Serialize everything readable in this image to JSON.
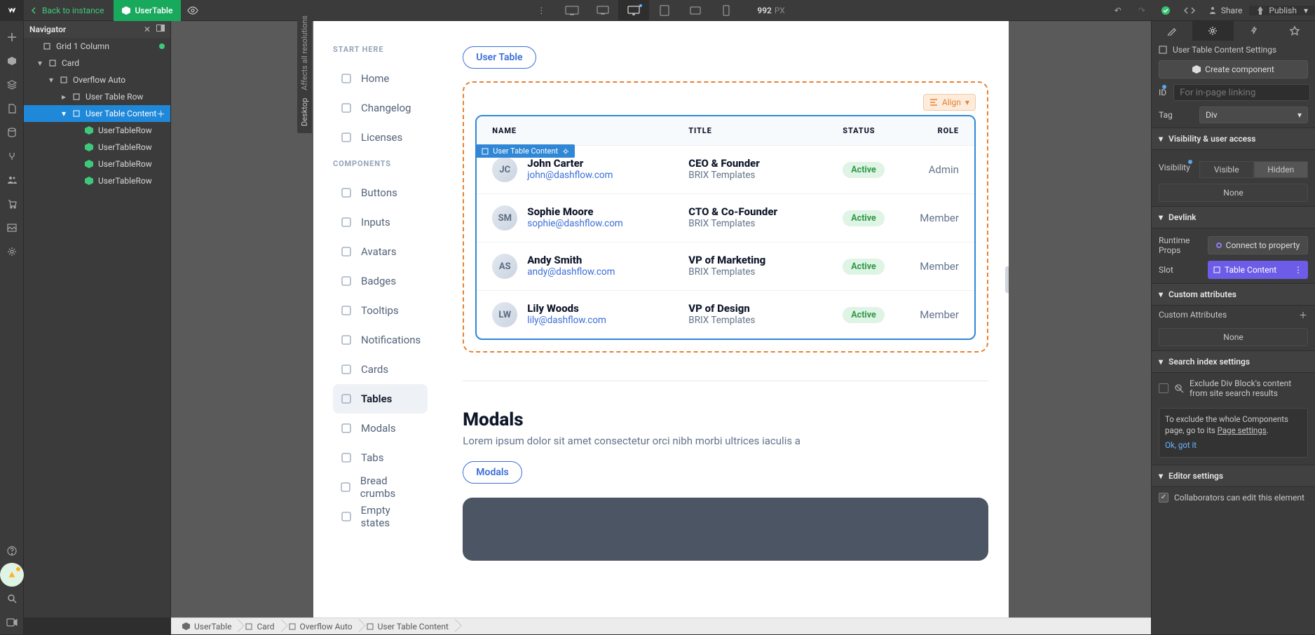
{
  "topbar": {
    "back": "Back to instance",
    "componentName": "UserTable",
    "canvasWidth": "992",
    "canvasUnit": "PX",
    "share": "Share",
    "publish": "Publish"
  },
  "desktopLabel": "Desktop",
  "affectsLabel": "Affects all resolutions",
  "navigator": {
    "title": "Navigator",
    "items": [
      {
        "level": 0,
        "icon": "square",
        "label": "Grid 1 Column",
        "caret": false,
        "dot": true
      },
      {
        "level": 1,
        "icon": "square",
        "label": "Card",
        "caret": true
      },
      {
        "level": 2,
        "icon": "square",
        "label": "Overflow Auto",
        "caret": true
      },
      {
        "level": 3,
        "icon": "square",
        "label": "User Table Row",
        "caret": true,
        "collapsed": true
      },
      {
        "level": 3,
        "icon": "square",
        "label": "User Table Content",
        "caret": true,
        "selected": true,
        "gear": true
      },
      {
        "level": 4,
        "icon": "comp",
        "label": "UserTableRow"
      },
      {
        "level": 4,
        "icon": "comp",
        "label": "UserTableRow"
      },
      {
        "level": 4,
        "icon": "comp",
        "label": "UserTableRow"
      },
      {
        "level": 4,
        "icon": "comp",
        "label": "UserTableRow"
      }
    ]
  },
  "sidebar": {
    "sections": [
      {
        "title": "START HERE",
        "items": [
          {
            "icon": "home",
            "label": "Home"
          },
          {
            "icon": "changelog",
            "label": "Changelog"
          },
          {
            "icon": "licenses",
            "label": "Licenses"
          }
        ]
      },
      {
        "title": "COMPONENTS",
        "items": [
          {
            "icon": "buttons",
            "label": "Buttons"
          },
          {
            "icon": "inputs",
            "label": "Inputs"
          },
          {
            "icon": "avatars",
            "label": "Avatars"
          },
          {
            "icon": "badges",
            "label": "Badges"
          },
          {
            "icon": "tooltips",
            "label": "Tooltips"
          },
          {
            "icon": "notifications",
            "label": "Notifications"
          },
          {
            "icon": "cards",
            "label": "Cards"
          },
          {
            "icon": "tables",
            "label": "Tables",
            "active": true
          },
          {
            "icon": "modals",
            "label": "Modals"
          },
          {
            "icon": "tabs",
            "label": "Tabs"
          },
          {
            "icon": "breadcrumbs",
            "label": "Bread crumbs"
          },
          {
            "icon": "empty",
            "label": "Empty states"
          }
        ]
      }
    ]
  },
  "userTable": {
    "pill": "User Table",
    "alignBtn": "Align",
    "selectedTag": "User Table Content",
    "headers": {
      "name": "NAME",
      "title": "TITLE",
      "status": "STATUS",
      "role": "ROLE"
    },
    "rows": [
      {
        "initials": "JC",
        "name": "John Carter",
        "email": "john@dashflow.com",
        "title": "CEO & Founder",
        "org": "BRIX Templates",
        "status": "Active",
        "role": "Admin"
      },
      {
        "initials": "SM",
        "name": "Sophie Moore",
        "email": "sophie@dashflow.com",
        "title": "CTO & Co-Founder",
        "org": "BRIX Templates",
        "status": "Active",
        "role": "Member"
      },
      {
        "initials": "AS",
        "name": "Andy Smith",
        "email": "andy@dashflow.com",
        "title": "VP of Marketing",
        "org": "BRIX Templates",
        "status": "Active",
        "role": "Member"
      },
      {
        "initials": "LW",
        "name": "Lily Woods",
        "email": "lily@dashflow.com",
        "title": "VP of Design",
        "org": "BRIX Templates",
        "status": "Active",
        "role": "Member"
      }
    ]
  },
  "modalsSection": {
    "title": "Modals",
    "desc": "Lorem ipsum dolor sit amet consectetur orci nibh morbi ultrices iaculis a",
    "pill": "Modals"
  },
  "breadcrumbs": [
    "UserTable",
    "Card",
    "Overflow Auto",
    "User Table Content"
  ],
  "inspector": {
    "headerLabel": "User Table Content Settings",
    "createBtn": "Create component",
    "idLabel": "ID",
    "idPlaceholder": "For in-page linking",
    "tagLabel": "Tag",
    "tagValue": "Div",
    "visibility": {
      "section": "Visibility & user access",
      "label": "Visibility",
      "visible": "Visible",
      "hidden": "Hidden",
      "none": "None"
    },
    "devlink": {
      "section": "Devlink",
      "runtime": "Runtime Props",
      "connect": "Connect to property",
      "slot": "Slot",
      "slotValue": "Table Content"
    },
    "custom": {
      "section": "Custom attributes",
      "label": "Custom Attributes",
      "none": "None"
    },
    "search": {
      "section": "Search index settings",
      "exclude": "Exclude Div Block's content from site search results",
      "note1": "To exclude the whole Components page, go to its ",
      "noteLink": "Page settings",
      "noteDot": ".",
      "ok": "Ok, got it"
    },
    "editor": {
      "section": "Editor settings",
      "check": "Collaborators can edit this element"
    }
  }
}
